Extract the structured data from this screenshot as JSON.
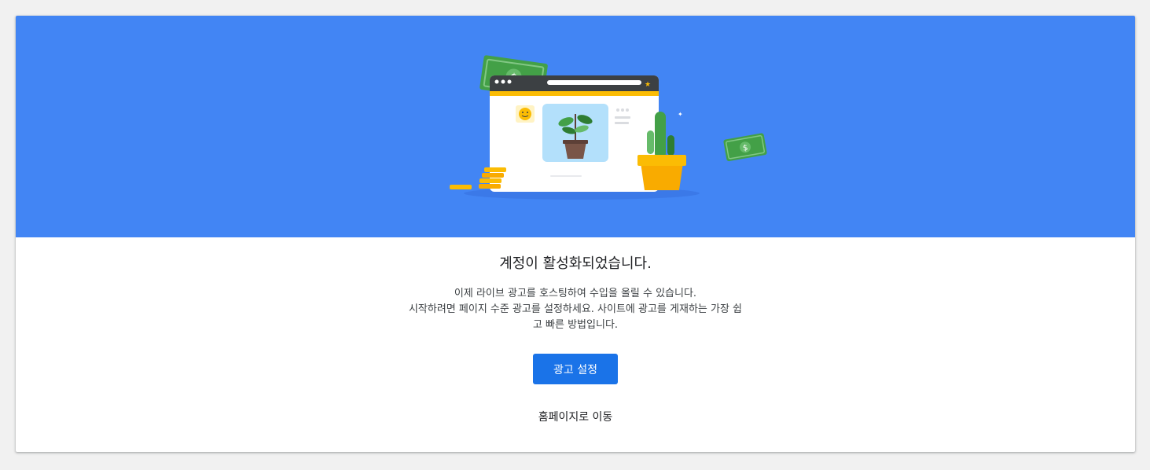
{
  "hero": {
    "illustration": "browser-window-with-plant-money-coins-cactus",
    "colors": {
      "background": "#4285f4",
      "money": "#43a047",
      "coin": "#fbbc04",
      "window_bar": "#3c4043",
      "pot": "#f9ab00"
    }
  },
  "main": {
    "title": "계정이 활성화되었습니다.",
    "description_lines": [
      "이제 라이브 광고를 호스팅하여 수입을 올릴 수 있습니다.",
      "시작하려면 페이지 수준 광고를 설정하세요. 사이트에 광고를 게재하는 가장 쉽",
      "고 빠른 방법입니다."
    ],
    "primary_button_label": "광고 설정",
    "secondary_link_label": "홈페이지로 이동",
    "accent_color": "#1a73e8"
  }
}
